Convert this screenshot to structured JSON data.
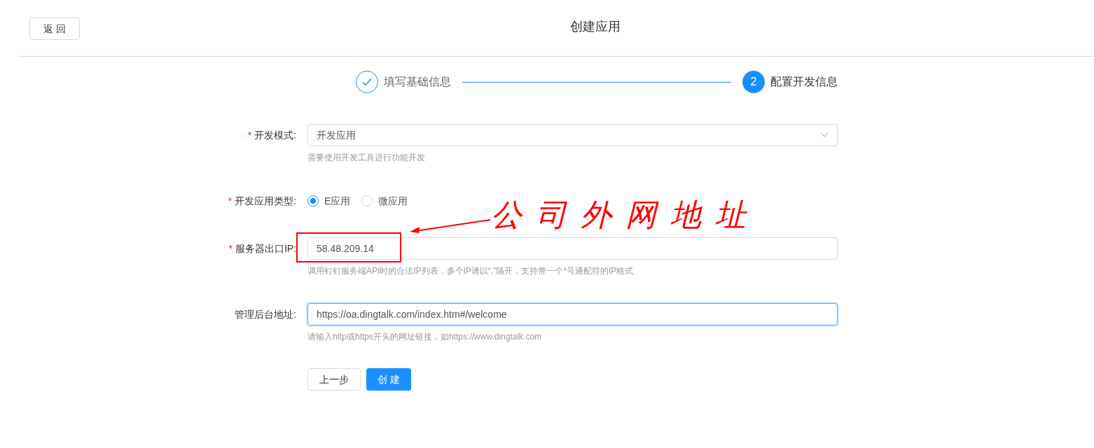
{
  "header": {
    "back_button": "返 回",
    "title": "创建应用"
  },
  "steps": [
    {
      "label": "填写基础信息",
      "done": true
    },
    {
      "label": "配置开发信息",
      "done": false,
      "number": "2"
    }
  ],
  "fields": [
    {
      "kind": "select",
      "label": "开发模式:",
      "required_mark": "*",
      "value": "开发应用",
      "hint": "需要使用开发工具进行功能开发"
    },
    {
      "kind": "radio",
      "label": "开发应用类型:",
      "required_mark": "*",
      "options": [
        {
          "label": "E应用",
          "selected": true
        },
        {
          "label": "微应用",
          "selected": false
        }
      ]
    },
    {
      "kind": "input",
      "label": "服务器出口IP:",
      "required_mark": "*",
      "value": "58.48.209.14",
      "focused": false,
      "hint": "调用钉钉服务端API时的合法IP列表，多个IP请以“,”隔开，支持带一个*号通配符的IP格式"
    },
    {
      "kind": "input",
      "label": "管理后台地址:",
      "value": "https://oa.dingtalk.com/index.htm#/welcome",
      "focused": true,
      "hint": "请输入http或https开头的网址链接，如https://www.dingtalk.com"
    }
  ],
  "buttons": {
    "prev": "上一步",
    "create": "创 建"
  },
  "annotation": {
    "text": "公司外网地址"
  }
}
